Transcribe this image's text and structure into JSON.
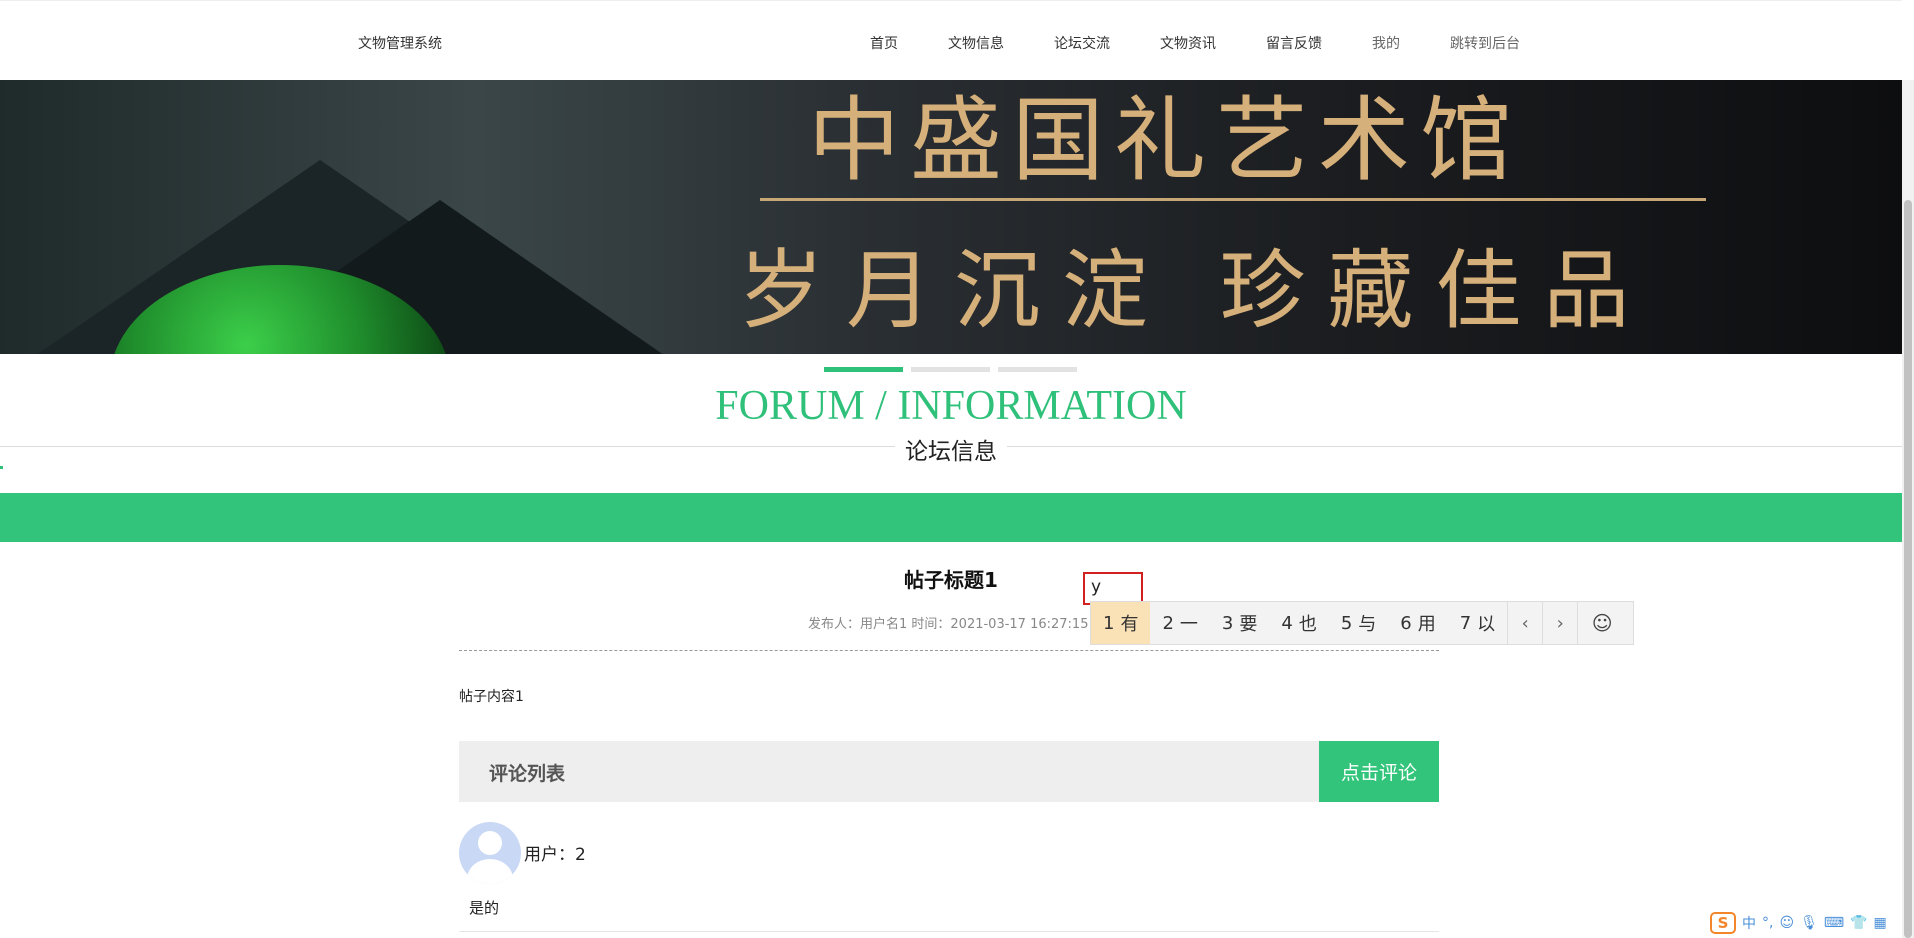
{
  "header": {
    "brand": "文物管理系统",
    "nav": [
      "首页",
      "文物信息",
      "论坛交流",
      "文物资讯",
      "留言反馈",
      "我的",
      "跳转到后台"
    ]
  },
  "banner": {
    "line1": "中盛国礼艺术馆",
    "line2": "岁月沉淀 珍藏佳品"
  },
  "section": {
    "title_en": "FORUM / INFORMATION",
    "title_cn": "论坛信息"
  },
  "post": {
    "title": "帖子标题1",
    "meta": "发布人：用户名1 时间：2021-03-17 16:27:15",
    "content": "帖子内容1"
  },
  "comments": {
    "header": "评论列表",
    "button": "点击评论",
    "items": [
      {
        "user": "用户：2",
        "text": "是的"
      }
    ]
  },
  "ime": {
    "composition": "y",
    "candidates": [
      {
        "n": "1",
        "w": "有"
      },
      {
        "n": "2",
        "w": "一"
      },
      {
        "n": "3",
        "w": "要"
      },
      {
        "n": "4",
        "w": "也"
      },
      {
        "n": "5",
        "w": "与"
      },
      {
        "n": "6",
        "w": "用"
      },
      {
        "n": "7",
        "w": "以"
      }
    ],
    "prev": "‹",
    "next": "›",
    "emoji": "☺",
    "tray_logo": "S",
    "tray_lang": "中"
  }
}
